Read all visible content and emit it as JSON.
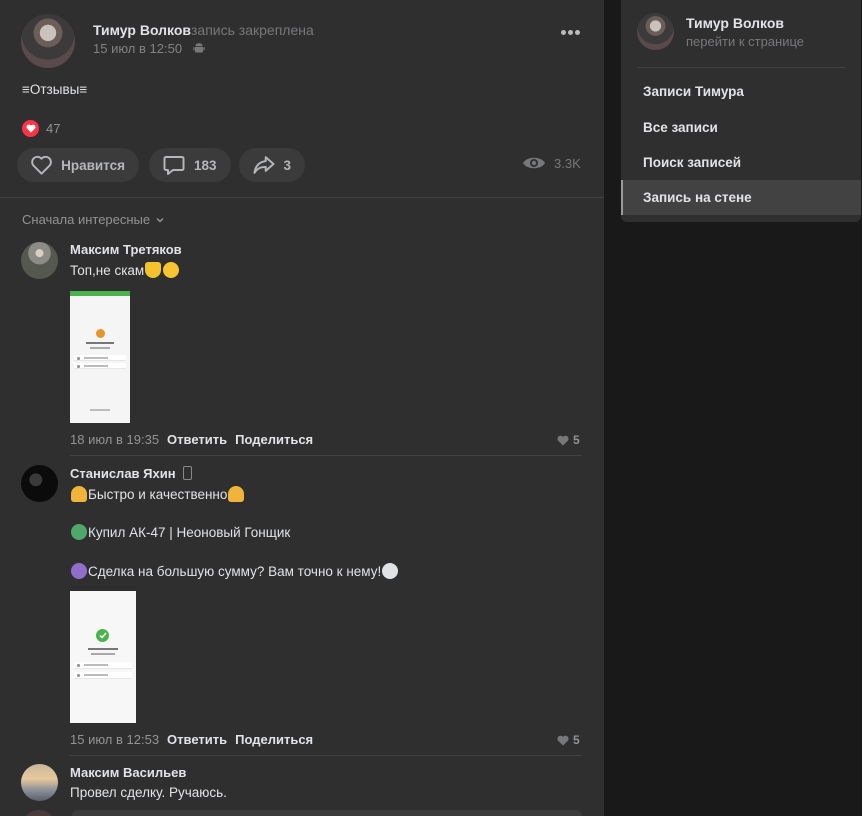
{
  "post": {
    "author": "Тимур Волков",
    "pinned_note": "запись закреплена",
    "date": "15 июл в 12:50",
    "text": "≡Отзывы≡",
    "reaction_count": "47",
    "like_label": "Нравится",
    "comments_count": "183",
    "shares_count": "3",
    "views": "3.3K"
  },
  "sort_label": "Сначала интересные",
  "comments": [
    {
      "author": "Максим Третяков",
      "text": "Топ,не скам",
      "date": "18 июл в 19:35",
      "reply": "Ответить",
      "share": "Поделиться",
      "likes": "5"
    },
    {
      "author": "Станислав Яхин",
      "line1": "Быстро и качественно",
      "line2": "Купил АК-47 | Неоновый Гонщик",
      "line3": "Сделка на большую сумму? Вам точно к нему!",
      "date": "15 июл в 12:53",
      "reply": "Ответить",
      "share": "Поделиться",
      "likes": "5"
    },
    {
      "author": "Максим Васильев",
      "text": "Провел сделку. Ручаюсь."
    }
  ],
  "sidebar": {
    "author": "Тимур Волков",
    "subtitle": "перейти к странице",
    "items": [
      {
        "label": "Записи Тимура"
      },
      {
        "label": "Все записи"
      },
      {
        "label": "Поиск записей"
      },
      {
        "label": "Запись на стене"
      }
    ]
  },
  "colors": {
    "background": "#19191a",
    "panel": "#2f2f30",
    "button": "#3b3b3c",
    "heart": "#ff3347",
    "active_item": "#424243"
  }
}
